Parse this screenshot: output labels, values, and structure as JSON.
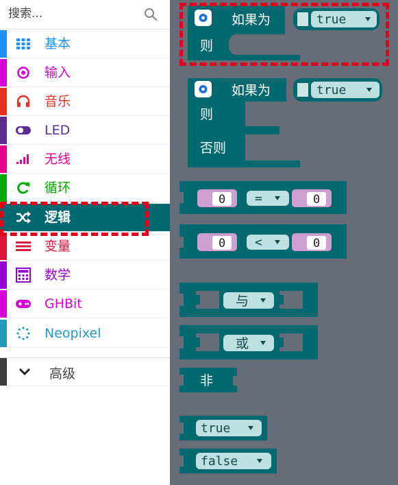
{
  "search": {
    "placeholder": "搜索..."
  },
  "categories": [
    {
      "label": "基本",
      "color": "#1e90ff",
      "icon": "grid-icon"
    },
    {
      "label": "输入",
      "color": "#d400d4",
      "icon": "input-target-icon"
    },
    {
      "label": "音乐",
      "color": "#e63022",
      "icon": "headphones-icon"
    },
    {
      "label": "LED",
      "color": "#5c2d91",
      "icon": "toggle-icon"
    },
    {
      "label": "无线",
      "color": "#e3008c",
      "icon": "signal-bars-icon"
    },
    {
      "label": "循环",
      "color": "#00aa00",
      "icon": "refresh-icon"
    },
    {
      "label": "逻辑",
      "color": "#00a4a6",
      "icon": "shuffle-icon"
    },
    {
      "label": "变量",
      "color": "#dc143c",
      "icon": "list-lines-icon"
    },
    {
      "label": "数学",
      "color": "#9400d3",
      "icon": "calculator-icon"
    },
    {
      "label": "GHBit",
      "color": "#d400d4",
      "icon": "gamepad-icon"
    },
    {
      "label": "Neopixel",
      "color": "#2699bf",
      "icon": "dotted-circle-icon"
    }
  ],
  "advanced": {
    "label": "高级",
    "icon": "chevron-down-icon"
  },
  "blocks": {
    "if_label": "如果为",
    "then_label": "则",
    "else_label": "否则",
    "true_value": "true",
    "false_value": "false",
    "zero": "0",
    "op_eq": "=",
    "op_lt": "<",
    "and_label": "与",
    "or_label": "或",
    "not_label": "非"
  },
  "colors": {
    "logic_block": "#006970",
    "logic_dark": "#00555b",
    "selected_bg": "#006970",
    "workspace": "#666d79",
    "highlight": "#e0001b"
  }
}
